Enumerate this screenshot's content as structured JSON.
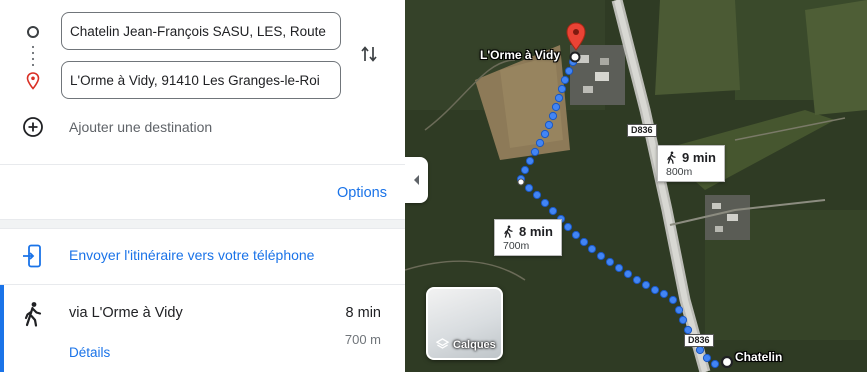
{
  "directions": {
    "origin_value": "Chatelin Jean-François SASU, LES, Route",
    "destination_value": "L'Orme à Vidy, 91410 Les Granges-le-Roi",
    "add_destination_label": "Ajouter une destination",
    "options_label": "Options",
    "send_to_phone_label": "Envoyer l'itinéraire vers votre téléphone",
    "route": {
      "via_label": "via L'Orme à Vidy",
      "duration": "8 min",
      "distance": "700 m",
      "details_label": "Détails"
    }
  },
  "map": {
    "destination_label": "L'Orme à Vidy",
    "origin_label": "Chatelin",
    "road_shields": [
      "D836",
      "D836"
    ],
    "alt_route": {
      "duration": "9 min",
      "distance": "800m"
    },
    "main_route": {
      "duration": "8 min",
      "distance": "700m"
    },
    "layers_label": "Calques",
    "colors": {
      "route_blue": "#1a73e8",
      "pin_red": "#ea4335",
      "accent": "#1a73e8"
    }
  }
}
